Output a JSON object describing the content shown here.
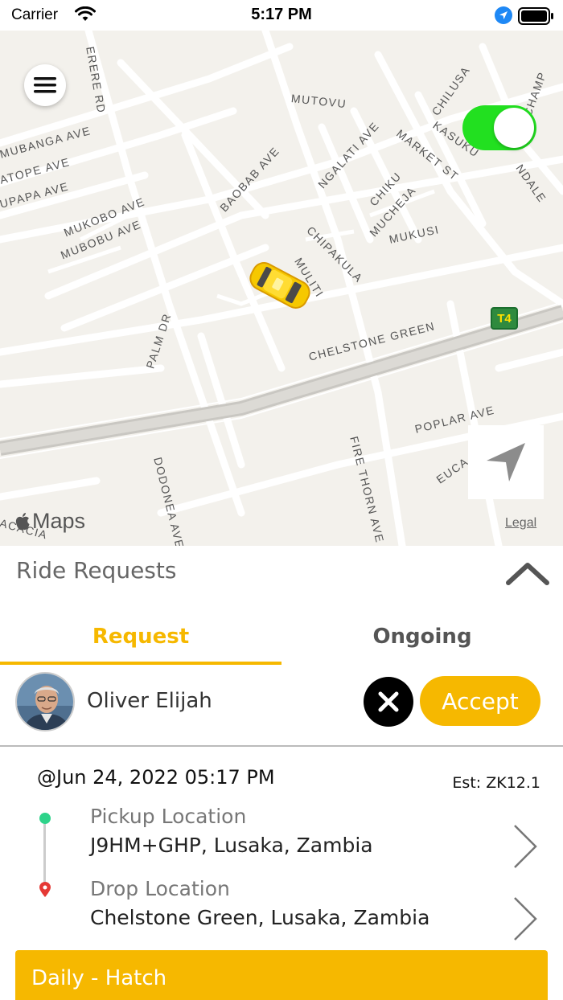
{
  "status_bar": {
    "carrier": "Carrier",
    "time": "5:17 PM",
    "icons": [
      "wifi-icon",
      "location-arrow-icon",
      "battery-icon"
    ]
  },
  "map": {
    "provider_label": "Maps",
    "legal_label": "Legal",
    "route_badge": "T4",
    "street_labels": [
      "MUTOVU",
      "CHILUSA",
      "MUBANGA AVE",
      "ATOPE AVE",
      "UPAPA AVE",
      "KASUKU",
      "MARKET ST",
      "NGALATI AVE",
      "BAOBAB AVE",
      "CHIKU",
      "MUCHEJA",
      "MUKUSI",
      "CHIPAKULA",
      "MUKOBO AVE",
      "MUBOBU AVE",
      "MULITI",
      "PALM DR",
      "CHELSTONE GREEN",
      "POPLAR AVE",
      "FIRE THORN AVE",
      "DODONEA AVE",
      "ACACIA",
      "NDALE",
      "CHAMP",
      "ERERE RD",
      "EUCA"
    ],
    "online_toggle": true
  },
  "sheet": {
    "title": "Ride Requests",
    "tabs": [
      {
        "label": "Request",
        "active": true
      },
      {
        "label": "Ongoing",
        "active": false
      }
    ]
  },
  "request": {
    "rider_name": "Oliver Elijah",
    "accept_label": "Accept",
    "datetime": "@Jun 24, 2022 05:17 PM",
    "estimate": "Est: ZK12.1",
    "pickup_label": "Pickup Location",
    "pickup_value": "J9HM+GHP, Lusaka, Zambia",
    "drop_label": "Drop Location",
    "drop_value": "Chelstone Green, Lusaka, Zambia",
    "ride_type": "Daily - Hatch"
  },
  "colors": {
    "accent": "#f6b800",
    "toggle_on": "#22e020",
    "pickup_dot": "#2ed38a",
    "drop_pin": "#e53935"
  }
}
